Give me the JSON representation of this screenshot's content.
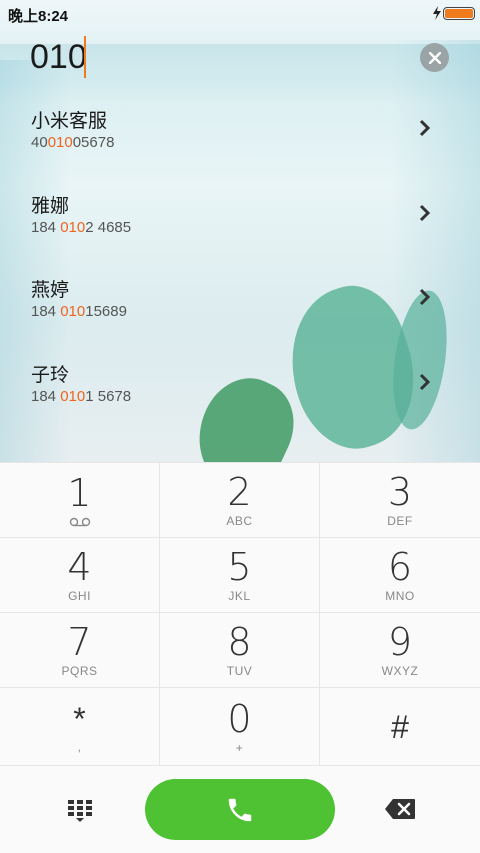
{
  "status_bar": {
    "time": "晚上8:24"
  },
  "input": {
    "number": "010"
  },
  "contacts": [
    {
      "name": "小米客服",
      "num_pre": "40",
      "num_hl": "010",
      "num_post": "05678"
    },
    {
      "name": "雅娜",
      "num_pre": "184 ",
      "num_hl": "010",
      "num_post": "2 4685"
    },
    {
      "name": "燕婷",
      "num_pre": "184 ",
      "num_hl": "010",
      "num_post": "15689"
    },
    {
      "name": "子玲",
      "num_pre": "184 ",
      "num_hl": "010",
      "num_post": "1 5678"
    }
  ],
  "keypad": {
    "k1": {
      "digit": "1",
      "letters": ""
    },
    "k2": {
      "digit": "2",
      "letters": "ABC"
    },
    "k3": {
      "digit": "3",
      "letters": "DEF"
    },
    "k4": {
      "digit": "4",
      "letters": "GHI"
    },
    "k5": {
      "digit": "5",
      "letters": "JKL"
    },
    "k6": {
      "digit": "6",
      "letters": "MNO"
    },
    "k7": {
      "digit": "7",
      "letters": "PQRS"
    },
    "k8": {
      "digit": "8",
      "letters": "TUV"
    },
    "k9": {
      "digit": "9",
      "letters": "WXYZ"
    },
    "kstar": {
      "digit": "*",
      "letters": ","
    },
    "k0": {
      "digit": "0",
      "letters": "+"
    },
    "khash": {
      "digit": "#",
      "letters": ""
    }
  },
  "colors": {
    "accent": "#f0641e",
    "call_green": "#4ec232",
    "battery": "#f07b1f"
  },
  "icons": {
    "clear": "close-icon",
    "chevron": "chevron-right-icon",
    "voicemail": "voicemail-icon",
    "dialpad": "dialpad-icon",
    "call": "phone-icon",
    "backspace": "backspace-icon"
  }
}
